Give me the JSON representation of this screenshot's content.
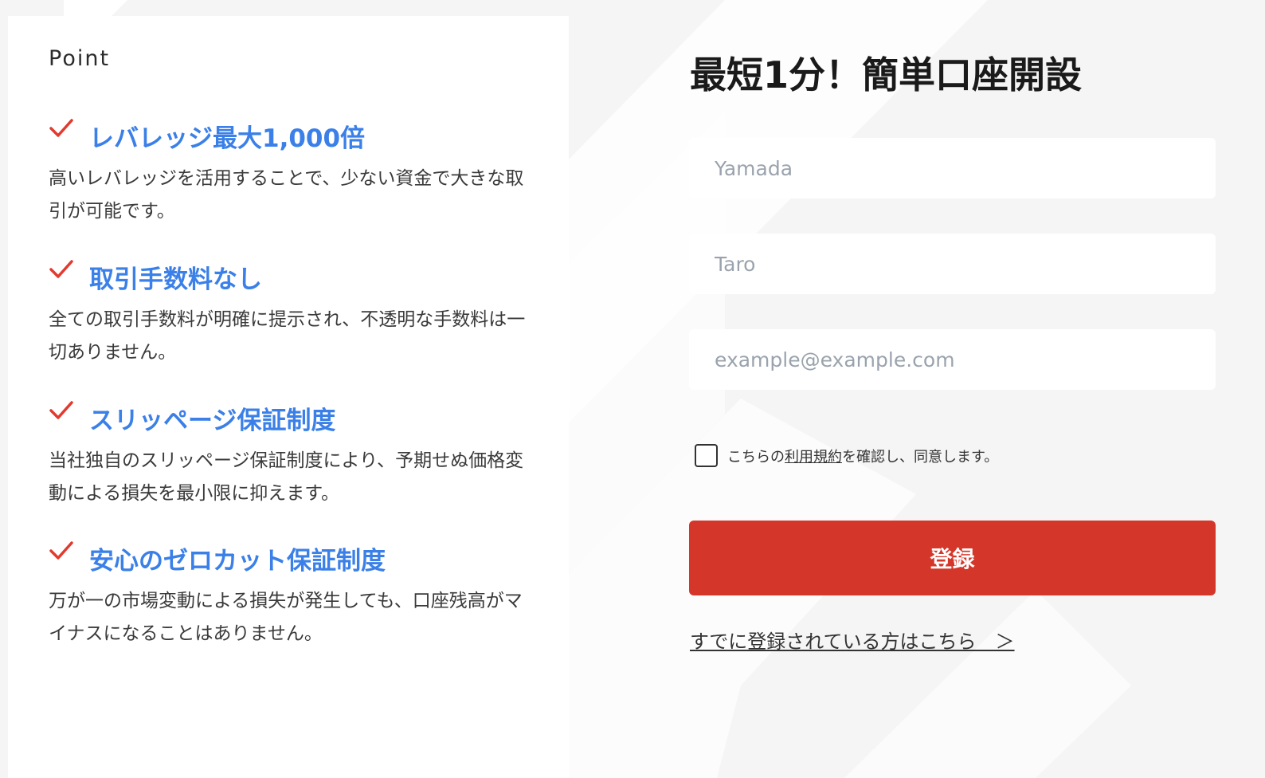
{
  "points": {
    "heading": "Point",
    "items": [
      {
        "title": "レバレッジ最大1,000倍",
        "description": "高いレバレッジを活用することで、少ない資金で大きな取引が可能です。"
      },
      {
        "title": "取引手数料なし",
        "description": "全ての取引手数料が明確に提示され、不透明な手数料は一切ありません。"
      },
      {
        "title": "スリッページ保証制度",
        "description": "当社独自のスリッページ保証制度により、予期せぬ価格変動による損失を最小限に抑えます。"
      },
      {
        "title": "安心のゼロカット保証制度",
        "description": "万が一の市場変動による損失が発生しても、口座残高がマイナスになることはありません。"
      }
    ]
  },
  "form": {
    "title": "最短1分！簡単口座開設",
    "last_name_placeholder": "Yamada",
    "first_name_placeholder": "Taro",
    "email_placeholder": "example@example.com",
    "consent_prefix": "こちらの",
    "consent_link": "利用規約",
    "consent_suffix": "を確認し、同意します。",
    "consent_checked": false,
    "submit_label": "登録",
    "login_link": "すでに登録されている方はこちら　＞"
  },
  "colors": {
    "accent_blue": "#3a80e8",
    "check_red": "#e23a2e",
    "button_red": "#d4372a",
    "background": "#f5f5f5"
  },
  "icons": {
    "check": "check-icon"
  }
}
